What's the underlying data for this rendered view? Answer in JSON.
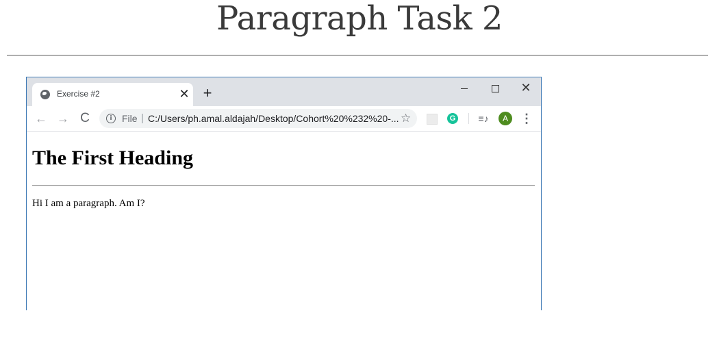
{
  "slide": {
    "title": "Paragraph Task 2"
  },
  "browser": {
    "tab": {
      "title": "Exercise #2",
      "favicon": "globe-icon",
      "close_glyph": "✕"
    },
    "new_tab_glyph": "+",
    "window_controls": {
      "minimize": "minimize-icon",
      "maximize": "maximize-icon",
      "close": "✕"
    },
    "toolbar": {
      "back_glyph": "←",
      "forward_glyph": "→",
      "reload_glyph": "C",
      "info_glyph": "i",
      "scheme_label": "File",
      "scheme_sep": "|",
      "url": "C:/Users/ph.amal.aldajah/Desktop/Cohort%20%232%20-...",
      "star_glyph": "☆",
      "grammarly_glyph": "G",
      "queue_glyph": "≡♪",
      "avatar_letter": "A",
      "menu_glyph": "⋮"
    },
    "page": {
      "heading": "The First Heading",
      "paragraph": "Hi I am a paragraph. Am I?"
    }
  },
  "colors": {
    "tabstrip": "#dee1e6",
    "window_border": "#3c78b4",
    "avatar": "#4e8c1f",
    "grammarly": "#15c39a"
  }
}
